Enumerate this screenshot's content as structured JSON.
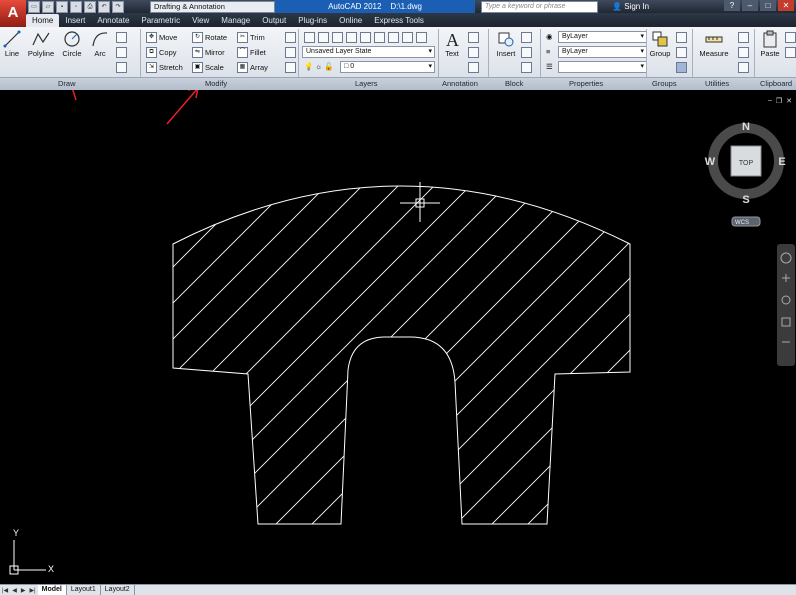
{
  "app": {
    "logo": "A",
    "title": "AutoCAD 2012",
    "file": "D:\\1.dwg",
    "workspace": "Drafting & Annotation",
    "search_placeholder": "Type a keyword or phrase",
    "sign_in": "Sign In",
    "help": "?"
  },
  "tabs": [
    "Home",
    "Insert",
    "Annotate",
    "Parametric",
    "View",
    "Manage",
    "Output",
    "Plug-ins",
    "Online",
    "Express Tools"
  ],
  "active_tab": "Home",
  "draw": {
    "title": "Draw",
    "line": "Line",
    "polyline": "Polyline",
    "circle": "Circle",
    "arc": "Arc"
  },
  "modify": {
    "title": "Modify",
    "move": "Move",
    "copy": "Copy",
    "stretch": "Stretch",
    "rotate": "Rotate",
    "mirror": "Mirror",
    "scale": "Scale",
    "trim": "Trim",
    "fillet": "Fillet",
    "array": "Array"
  },
  "layers": {
    "title": "Layers",
    "layer_state": "Unsaved Layer State",
    "current_layer": "0"
  },
  "annotation": {
    "title": "Annotation",
    "text": "Text"
  },
  "block": {
    "title": "Block",
    "insert": "Insert"
  },
  "properties": {
    "title": "Properties",
    "color": "ByLayer",
    "linetype": "ByLayer"
  },
  "groups": {
    "title": "Groups",
    "group": "Group"
  },
  "utilities": {
    "title": "Utilities",
    "measure": "Measure"
  },
  "clipboard": {
    "title": "Clipboard",
    "paste": "Paste"
  },
  "viewcube": {
    "n": "N",
    "s": "S",
    "e": "E",
    "w": "W",
    "face": "TOP",
    "wcs": "WCS"
  },
  "ucs": {
    "x": "X",
    "y": "Y"
  },
  "layout_tabs": [
    "Model",
    "Layout1",
    "Layout2"
  ],
  "active_layout": "Model",
  "colors": {
    "annotation_arrows": "#e8202a",
    "drawing_background": "#000000",
    "geometry": "#ffffff",
    "title_highlight": "#1a5fb4"
  }
}
